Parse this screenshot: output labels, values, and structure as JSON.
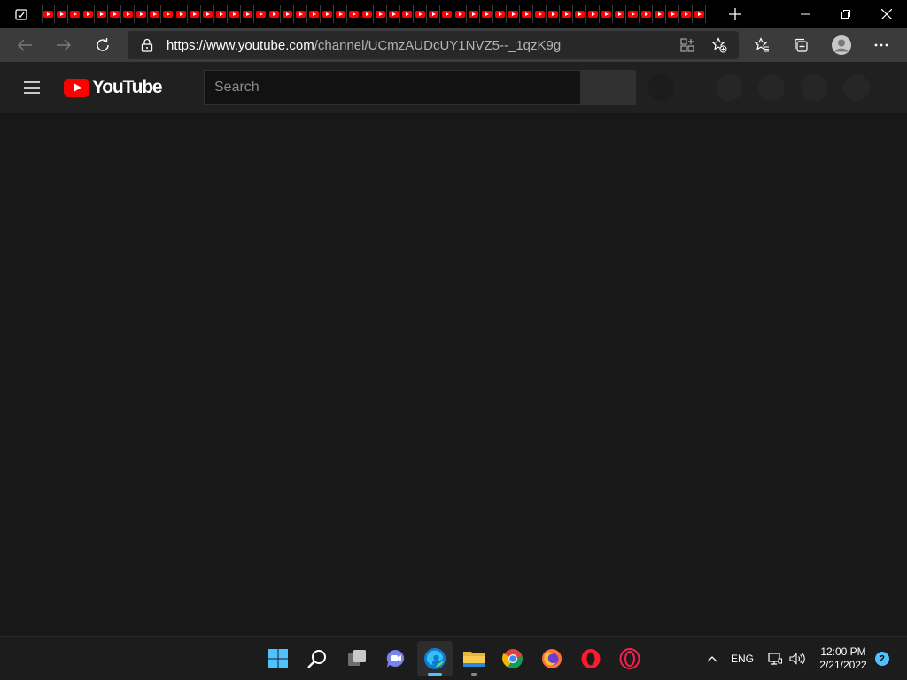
{
  "browser": {
    "tab_count": 50,
    "tab_favicon": "youtube-favicon",
    "url_host": "https://www.youtube.com",
    "url_path": "/channel/UCmzAUDcUY1NVZ5--_1qzK9g",
    "icons": {
      "tab_actions": "tab-actions-icon",
      "new_tab": "plus-icon",
      "minimize": "minimize-icon",
      "restore": "restore-icon",
      "close": "close-icon",
      "back": "back-arrow-icon",
      "forward": "forward-arrow-icon",
      "refresh": "refresh-icon",
      "lock": "lock-icon",
      "apps": "app-available-icon",
      "add_favorite": "add-favorite-icon",
      "favorites": "favorites-icon",
      "collections": "collections-icon",
      "profile": "profile-avatar-icon",
      "menu": "more-menu-icon"
    }
  },
  "youtube": {
    "logo_text": "YouTube",
    "search_placeholder": "Search",
    "brand_color": "#ff0000",
    "page_background": "#181818"
  },
  "taskbar": {
    "apps": [
      "start-icon",
      "search-icon",
      "task-view-icon",
      "teams-chat-icon",
      "edge-icon",
      "file-explorer-icon",
      "chrome-icon",
      "firefox-icon",
      "opera-icon",
      "opera-gx-icon"
    ],
    "active_app": "edge-icon",
    "language": "ENG",
    "time": "12:00 PM",
    "date": "2/21/2022",
    "notification_count": "2",
    "accent": "#4cc2ff"
  }
}
